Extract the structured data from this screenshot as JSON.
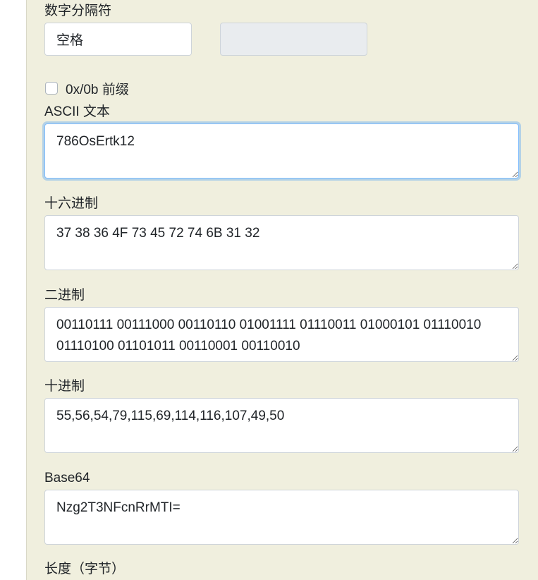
{
  "separator": {
    "label": "数字分隔符",
    "value": "空格",
    "second_value": ""
  },
  "prefix_option": {
    "label": "0x/0b 前缀",
    "checked": false
  },
  "ascii": {
    "label": "ASCII 文本",
    "value": "786OsErtk12"
  },
  "hex": {
    "label": "十六进制",
    "value": "37 38 36 4F 73 45 72 74 6B 31 32"
  },
  "binary": {
    "label": "二进制",
    "value": "00110111 00111000 00110110 01001111 01110011 01000101 01110010 01110100 01101011 00110001 00110010"
  },
  "decimal": {
    "label": "十进制",
    "value": "55,56,54,79,115,69,114,116,107,49,50"
  },
  "base64": {
    "label": "Base64",
    "value": "Nzg2T3NFcnRrMTI="
  },
  "length": {
    "label": "长度（字节）"
  }
}
